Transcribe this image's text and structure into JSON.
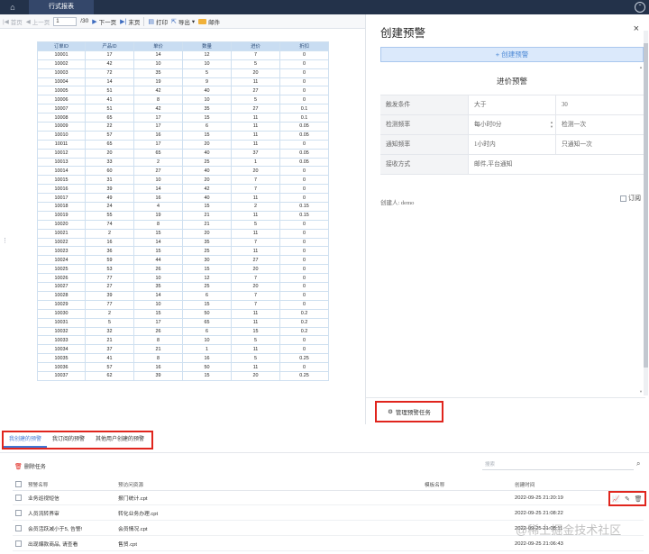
{
  "top": {
    "home_icon": "⌂",
    "tab_label": "行式报表",
    "right_icon": "⌃"
  },
  "toolbar": {
    "first": "首页",
    "prev": "上一页",
    "page_value": "1",
    "total": "/30",
    "next": "下一页",
    "last": "末页",
    "print": "打印",
    "export": "导出",
    "mail": "邮件"
  },
  "table": {
    "headers": [
      "订单ID",
      "产品ID",
      "单价",
      "数量",
      "进价",
      "折扣"
    ],
    "rows": [
      [
        "10001",
        "17",
        "14",
        "12",
        "7",
        "0"
      ],
      [
        "10002",
        "42",
        "10",
        "10",
        "5",
        "0"
      ],
      [
        "10003",
        "72",
        "35",
        "5",
        "20",
        "0"
      ],
      [
        "10004",
        "14",
        "19",
        "9",
        "11",
        "0"
      ],
      [
        "10005",
        "51",
        "42",
        "40",
        "27",
        "0"
      ],
      [
        "10006",
        "41",
        "8",
        "10",
        "5",
        "0"
      ],
      [
        "10007",
        "51",
        "42",
        "35",
        "27",
        "0.1"
      ],
      [
        "10008",
        "65",
        "17",
        "15",
        "11",
        "0.1"
      ],
      [
        "10009",
        "22",
        "17",
        "6",
        "11",
        "0.05"
      ],
      [
        "10010",
        "57",
        "16",
        "15",
        "11",
        "0.05"
      ],
      [
        "10011",
        "65",
        "17",
        "20",
        "11",
        "0"
      ],
      [
        "10012",
        "20",
        "65",
        "40",
        "37",
        "0.05"
      ],
      [
        "10013",
        "33",
        "2",
        "25",
        "1",
        "0.05"
      ],
      [
        "10014",
        "60",
        "27",
        "40",
        "20",
        "0"
      ],
      [
        "10015",
        "31",
        "10",
        "20",
        "7",
        "0"
      ],
      [
        "10016",
        "39",
        "14",
        "42",
        "7",
        "0"
      ],
      [
        "10017",
        "49",
        "16",
        "40",
        "11",
        "0"
      ],
      [
        "10018",
        "24",
        "4",
        "15",
        "2",
        "0.15"
      ],
      [
        "10019",
        "55",
        "19",
        "21",
        "11",
        "0.15"
      ],
      [
        "10020",
        "74",
        "8",
        "21",
        "5",
        "0"
      ],
      [
        "10021",
        "2",
        "15",
        "20",
        "11",
        "0"
      ],
      [
        "10022",
        "16",
        "14",
        "35",
        "7",
        "0"
      ],
      [
        "10023",
        "36",
        "15",
        "25",
        "11",
        "0"
      ],
      [
        "10024",
        "59",
        "44",
        "30",
        "27",
        "0"
      ],
      [
        "10025",
        "53",
        "26",
        "15",
        "20",
        "0"
      ],
      [
        "10026",
        "77",
        "10",
        "12",
        "7",
        "0"
      ],
      [
        "10027",
        "27",
        "35",
        "25",
        "20",
        "0"
      ],
      [
        "10028",
        "39",
        "14",
        "6",
        "7",
        "0"
      ],
      [
        "10029",
        "77",
        "10",
        "15",
        "7",
        "0"
      ],
      [
        "10030",
        "2",
        "15",
        "50",
        "11",
        "0.2"
      ],
      [
        "10031",
        "5",
        "17",
        "65",
        "11",
        "0.2"
      ],
      [
        "10032",
        "32",
        "26",
        "6",
        "15",
        "0.2"
      ],
      [
        "10033",
        "21",
        "8",
        "10",
        "5",
        "0"
      ],
      [
        "10034",
        "37",
        "21",
        "1",
        "11",
        "0"
      ],
      [
        "10035",
        "41",
        "8",
        "16",
        "5",
        "0.25"
      ],
      [
        "10036",
        "57",
        "16",
        "50",
        "11",
        "0"
      ],
      [
        "10037",
        "62",
        "39",
        "15",
        "20",
        "0.25"
      ]
    ]
  },
  "panel": {
    "title": "创建预警",
    "close_icon": "×",
    "create_button": "+ 创建预警",
    "form_title": "进价预警",
    "fields": [
      {
        "label": "触发条件",
        "value1": "大于",
        "value2": "30"
      },
      {
        "label": "检测频率",
        "value1": "每小时0分",
        "value2": "检测一次"
      },
      {
        "label": "通知频率",
        "value1": "1小时内",
        "value2": "只通知一次"
      },
      {
        "label": "接收方式",
        "value": "邮件,平台通知"
      }
    ],
    "creator": "创建人: demo",
    "subscribe": "订阅",
    "manage_button": "管理预警任务",
    "manage_icon": "⚙"
  },
  "tabs": [
    "我创建的预警",
    "我订阅的预警",
    "其他用户创建的预警"
  ],
  "list": {
    "delete_label": "删除任务",
    "search_placeholder": "搜索",
    "headers": {
      "name": "预警名称",
      "resource": "预访问资源",
      "template": "模板名称",
      "time": "创建时间"
    },
    "rows": [
      {
        "name": "业务巡视短信",
        "resource": "报门统计.cpt",
        "template": "",
        "time": "2022-09-25 21:20:19"
      },
      {
        "name": "人员流转界审",
        "resource": "转化业务办理.cpt",
        "template": "",
        "time": "2022-09-25 21:08:22"
      },
      {
        "name": "会员活跃减小于5, 告警!",
        "resource": "会员情况.cpt",
        "template": "",
        "time": "2022-09-25 21:08:11"
      },
      {
        "name": "出现爆款商品, 请查看",
        "resource": "售贸.cpt",
        "template": "",
        "time": "2022-09-25 21:06:43"
      }
    ],
    "action_icons": [
      "chart-icon",
      "edit-icon",
      "trash-icon"
    ]
  },
  "watermark": "@稀土掘金技术社区"
}
